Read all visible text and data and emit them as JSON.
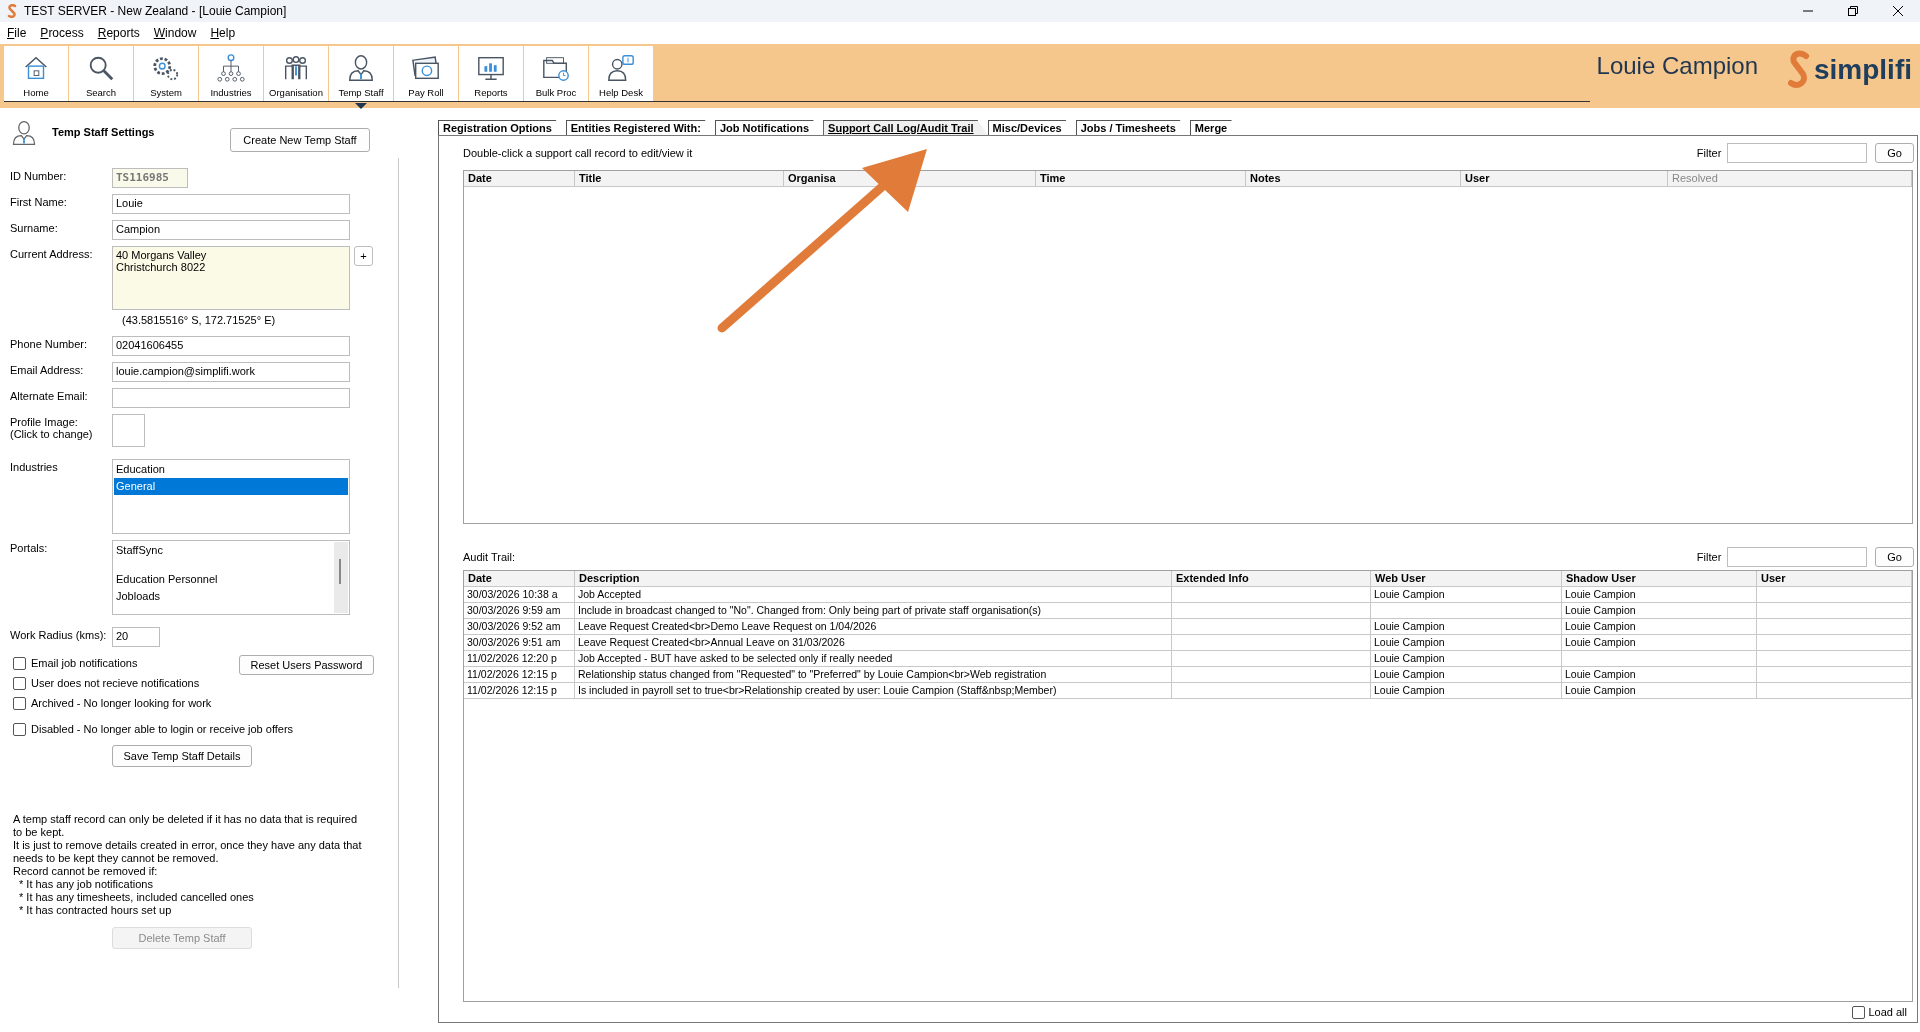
{
  "window": {
    "title": "TEST SERVER - New Zealand - [Louie Campion]"
  },
  "menu": [
    "File",
    "Process",
    "Reports",
    "Window",
    "Help"
  ],
  "toolbar": [
    {
      "label": "Home",
      "selected": false
    },
    {
      "label": "Search",
      "selected": false
    },
    {
      "label": "System",
      "selected": false
    },
    {
      "label": "Industries",
      "selected": false
    },
    {
      "label": "Organisation",
      "selected": false
    },
    {
      "label": "Temp Staff",
      "selected": true
    },
    {
      "label": "Pay Roll",
      "selected": false
    },
    {
      "label": "Reports",
      "selected": false
    },
    {
      "label": "Bulk Proc",
      "selected": false
    },
    {
      "label": "Help Desk",
      "selected": false
    }
  ],
  "user_name": "Louie Campion",
  "logo": "simplifi",
  "staff_form": {
    "heading": "Temp Staff Settings",
    "create_button": "Create New Temp Staff",
    "id_number": {
      "label": "ID Number:",
      "value": "TS116985"
    },
    "first_name": {
      "label": "First Name:",
      "value": "Louie"
    },
    "surname": {
      "label": "Surname:",
      "value": "Campion"
    },
    "address": {
      "label": "Current Address:",
      "lines": [
        "40 Morgans Valley",
        "Christchurch 8022"
      ],
      "add_button": "+",
      "coords": "(43.5815516° S, 172.71525° E)"
    },
    "phone": {
      "label": "Phone Number:",
      "value": "02041606455"
    },
    "email": {
      "label": "Email Address:",
      "value": "louie.campion@simplifi.work"
    },
    "alternate_email": {
      "label": "Alternate Email:"
    },
    "profile_image": {
      "label_lines": [
        "Profile Image:",
        "(Click to change)"
      ]
    },
    "industries": {
      "label": "Industries",
      "items": [
        {
          "label": "Education",
          "selected": false
        },
        {
          "label": "General",
          "selected": true
        }
      ]
    },
    "portals": {
      "label": "Portals:",
      "items": [
        "StaffSync",
        "Education Personnel",
        "Jobloads"
      ]
    },
    "work_radius": {
      "label": "Work Radius (kms):",
      "value": "20"
    },
    "checkboxes": [
      {
        "label": "Email job notifications",
        "checked": false
      },
      {
        "label": "User does not recieve notifications",
        "checked": false
      },
      {
        "label": "Archived - No longer looking for work",
        "checked": false
      },
      {
        "label": "Disabled - No longer able to login or receive job offers",
        "checked": false
      }
    ],
    "reset_button": "Reset Users Password",
    "save_button": "Save Temp Staff Details",
    "delete_note": [
      "A temp staff record can only be deleted if it has no data that is required to be kept.",
      "It is just to remove details created in error, once they have any data that needs to be kept they cannot be removed.",
      "Record cannot be removed if:"
    ],
    "delete_conditions": [
      "* It has any job notifications",
      "* It has any timesheets, included cancelled ones",
      "* It has contracted hours set up"
    ],
    "delete_button": {
      "label": "Delete Temp Staff",
      "disabled": true
    }
  },
  "tabs": [
    {
      "label": "Registration Options",
      "selected": false
    },
    {
      "label": "Entities Registered With:",
      "selected": false
    },
    {
      "label": "Job Notifications",
      "selected": false
    },
    {
      "label": "Support Call Log/Audit Trail",
      "selected": true
    },
    {
      "label": "Misc/Devices",
      "selected": false
    },
    {
      "label": "Jobs / Timesheets",
      "selected": false
    },
    {
      "label": "Merge",
      "selected": false
    }
  ],
  "support_calls": {
    "hint": "Double-click a support call record to edit/view it",
    "filter_label": "Filter",
    "go_button": "Go",
    "columns": [
      {
        "label": "Date",
        "disabled": false
      },
      {
        "label": "Title",
        "disabled": false
      },
      {
        "label": "Organisa",
        "disabled": false
      },
      {
        "label": "Time",
        "disabled": false
      },
      {
        "label": "Notes",
        "disabled": false
      },
      {
        "label": "User",
        "disabled": false
      },
      {
        "label": "Resolved",
        "disabled": true
      }
    ]
  },
  "audit_trail": {
    "label": "Audit Trail:",
    "filter_label": "Filter",
    "go_button": "Go",
    "columns": [
      "Date",
      "Description",
      "Extended Info",
      "Web User",
      "Shadow User",
      "User"
    ],
    "rows": [
      [
        "30/03/2026 10:38 a",
        "Job Accepted",
        "",
        "Louie Campion",
        "Louie Campion",
        ""
      ],
      [
        "30/03/2026 9:59 am",
        "Include in broadcast changed to \"No\". Changed from: Only being part of private staff organisation(s)",
        "",
        "",
        "Louie Campion",
        ""
      ],
      [
        "30/03/2026 9:52 am",
        "Leave Request Created<br>Demo Leave Request on 1/04/2026",
        "",
        "Louie Campion",
        "Louie Campion",
        ""
      ],
      [
        "30/03/2026 9:51 am",
        "Leave Request Created<br>Annual Leave on 31/03/2026",
        "",
        "Louie Campion",
        "Louie Campion",
        ""
      ],
      [
        "11/02/2026 12:20 p",
        "Job Accepted - BUT have asked to be selected only if really needed",
        "",
        "Louie Campion",
        "",
        ""
      ],
      [
        "11/02/2026 12:15 p",
        "Relationship status changed from \"Requested\" to \"Preferred\" by Louie Campion<br>Web registration",
        "",
        "Louie Campion",
        "Louie Campion",
        ""
      ],
      [
        "11/02/2026 12:15 p",
        "Is included in payroll set to true<br>Relationship created by user: Louie Campion (Staff&nbsp;Member)",
        "",
        "Louie Campion",
        "Louie Campion",
        ""
      ]
    ]
  },
  "load_all": {
    "label": "Load all",
    "checked": false
  }
}
